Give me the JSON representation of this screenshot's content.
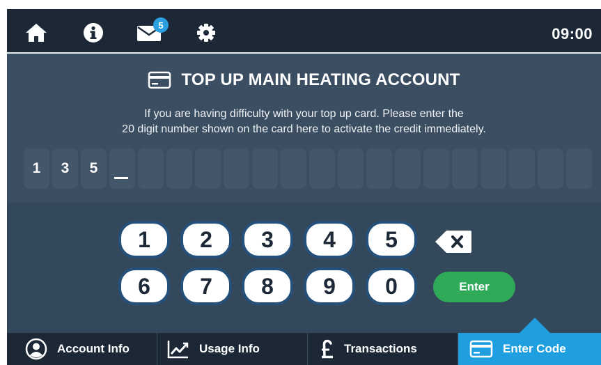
{
  "topbar": {
    "icons": [
      "home-icon",
      "info-icon",
      "mail-icon",
      "settings-icon"
    ],
    "mail_badge": "5",
    "clock": "09:00"
  },
  "main": {
    "title": "TOP UP MAIN HEATING ACCOUNT",
    "desc_line1": "If you are having difficulty with your top up card. Please enter the",
    "desc_line2": "20 digit number shown on the card here to activate the credit immediately.",
    "code_digits": [
      "1",
      "3",
      "5",
      "",
      "",
      "",
      "",
      "",
      "",
      "",
      "",
      "",
      "",
      "",
      "",
      "",
      "",
      "",
      "",
      ""
    ]
  },
  "keypad": {
    "keys": [
      "1",
      "2",
      "3",
      "4",
      "5",
      "6",
      "7",
      "9",
      "0"
    ],
    "key_row1": [
      "1",
      "2",
      "3",
      "4",
      "5"
    ],
    "key_row2": [
      "6",
      "7",
      "8",
      "9",
      "0"
    ],
    "backspace_icon": "backspace-icon",
    "enter_label": "Enter"
  },
  "nav": {
    "items": [
      {
        "label": "Account Info",
        "icon": "user-circle-icon"
      },
      {
        "label": "Usage Info",
        "icon": "chart-line-icon"
      },
      {
        "label": "Transactions",
        "icon": "pound-icon"
      },
      {
        "label": "Enter Code",
        "icon": "card-icon"
      }
    ],
    "active_index": 3
  },
  "colors": {
    "topbar_bg": "#1c2836",
    "main_bg": "#3b4e62",
    "accent_blue": "#1f9fe0",
    "enter_green": "#2eaa58"
  }
}
